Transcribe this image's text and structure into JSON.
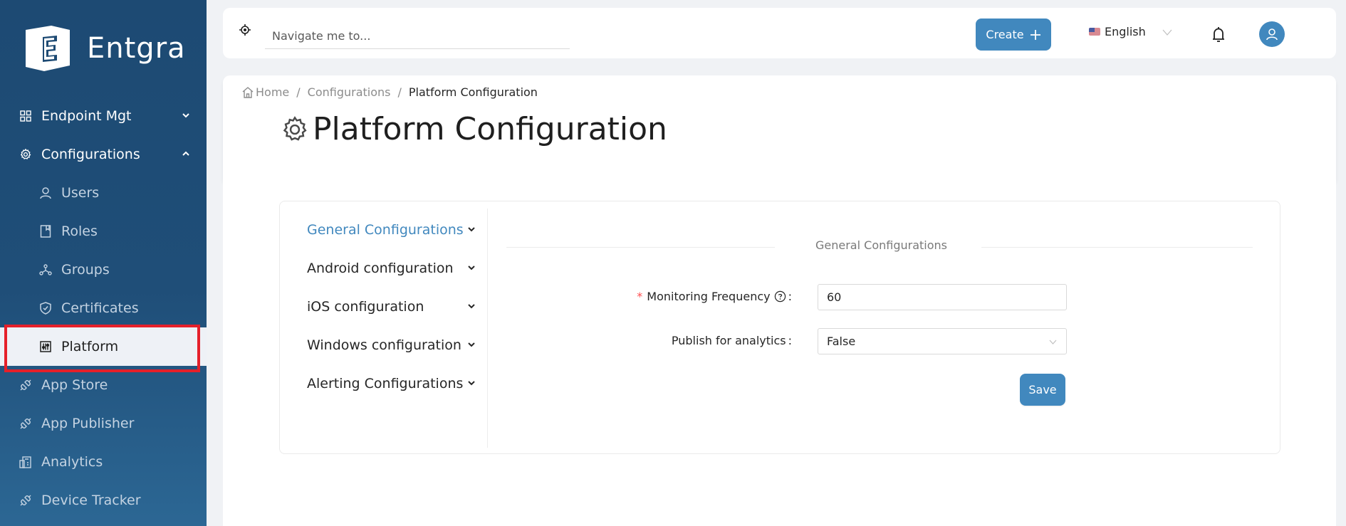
{
  "sidebar": {
    "brand": "Entgra",
    "items": [
      {
        "label": "Endpoint Mgt",
        "icon": "grid-icon",
        "expanded": false
      },
      {
        "label": "Configurations",
        "icon": "gear-icon",
        "expanded": true
      },
      {
        "label": "Users",
        "icon": "user-icon"
      },
      {
        "label": "Roles",
        "icon": "book-icon"
      },
      {
        "label": "Groups",
        "icon": "cluster-icon"
      },
      {
        "label": "Certificates",
        "icon": "shield-check-icon"
      },
      {
        "label": "Platform",
        "icon": "sliders-icon",
        "active": true
      },
      {
        "label": "App Store",
        "icon": "plug-icon"
      },
      {
        "label": "App Publisher",
        "icon": "plug-icon"
      },
      {
        "label": "Analytics",
        "icon": "reconciliation-icon"
      },
      {
        "label": "Device Tracker",
        "icon": "plug-icon"
      }
    ]
  },
  "topbar": {
    "search_placeholder": "Navigate me to...",
    "create_label": "Create",
    "language": "English"
  },
  "breadcrumb": {
    "home": "Home",
    "parent": "Configurations",
    "current": "Platform Configuration"
  },
  "page": {
    "title": "Platform Configuration"
  },
  "config_menu": {
    "items": [
      {
        "label": "General Configurations",
        "active": true
      },
      {
        "label": "Android configuration"
      },
      {
        "label": "iOS configuration"
      },
      {
        "label": "Windows configuration"
      },
      {
        "label": "Alerting Configurations"
      }
    ]
  },
  "form": {
    "section_title": "General Configurations",
    "monitoring_frequency": {
      "label": "Monitoring Frequency",
      "required": true,
      "value": "60"
    },
    "publish_analytics": {
      "label": "Publish for analytics",
      "value": "False"
    },
    "save_label": "Save"
  },
  "colors": {
    "sidebar": "#1d4a73",
    "accent": "#4188be",
    "highlight": "#e5202a"
  }
}
